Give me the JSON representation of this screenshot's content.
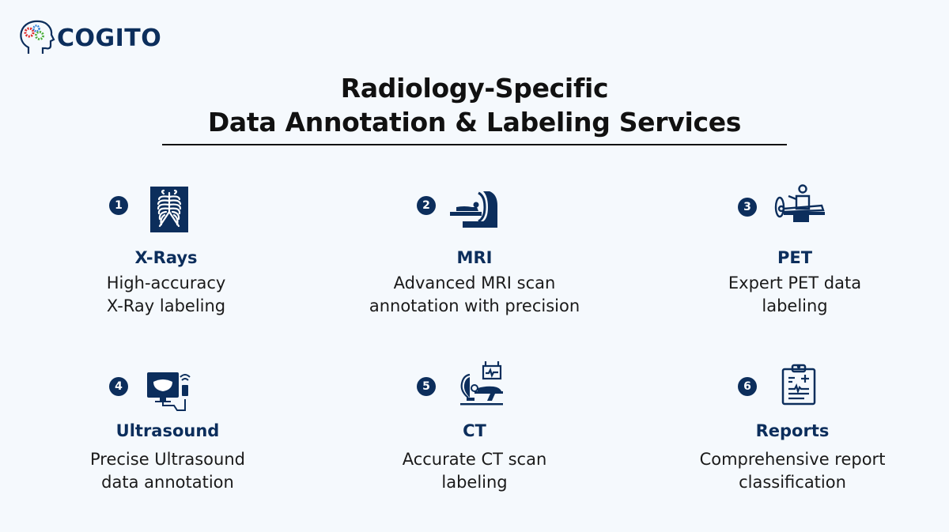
{
  "brand": {
    "name": "COGITO",
    "color": "#0c2e5c"
  },
  "header": {
    "title_line1": "Radiology-Specific",
    "title_line2": "Data Annotation & Labeling Services"
  },
  "services": [
    {
      "number": "1",
      "icon": "xray-ribcage-icon",
      "title": "X-Rays",
      "desc_line1": "High-accuracy",
      "desc_line2": "X-Ray labeling"
    },
    {
      "number": "2",
      "icon": "mri-scanner-icon",
      "title": "MRI",
      "desc_line1": "Advanced MRI scan",
      "desc_line2": "annotation with precision"
    },
    {
      "number": "3",
      "icon": "pet-scanner-icon",
      "title": "PET",
      "desc_line1": "Expert PET data",
      "desc_line2": "labeling"
    },
    {
      "number": "4",
      "icon": "ultrasound-monitor-icon",
      "title": "Ultrasound",
      "desc_line1": "Precise Ultrasound",
      "desc_line2": "data annotation"
    },
    {
      "number": "5",
      "icon": "ct-scanner-icon",
      "title": "CT",
      "desc_line1": "Accurate CT scan",
      "desc_line2": "labeling"
    },
    {
      "number": "6",
      "icon": "clipboard-report-icon",
      "title": "Reports",
      "desc_line1": "Comprehensive report",
      "desc_line2": "classification"
    }
  ]
}
